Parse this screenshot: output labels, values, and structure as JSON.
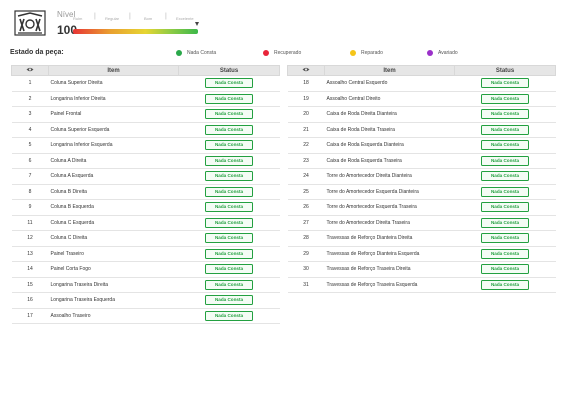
{
  "header": {
    "nivel_label": "Nível",
    "nivel_value": "100",
    "scale_labels": [
      "Ruim",
      "Regular",
      "Bom",
      "Excelente"
    ],
    "scale_level_percent": 100
  },
  "estado": {
    "title": "Estado da peça:",
    "legend": [
      {
        "label": "Nada Consta",
        "color": "#2aa84a"
      },
      {
        "label": "Recuperado",
        "color": "#e8253a"
      },
      {
        "label": "Reparado",
        "color": "#f5c518"
      },
      {
        "label": "Avariado",
        "color": "#9b30c9"
      }
    ]
  },
  "table": {
    "col_item": "Item",
    "col_status": "Status",
    "eye_icon": "eye-icon",
    "status_color": "#23a040"
  },
  "left_rows": [
    {
      "num": "1",
      "item": "Coluna Superior Direita",
      "status": "Nada Consta"
    },
    {
      "num": "2",
      "item": "Longarina Inferior Direita",
      "status": "Nada Consta"
    },
    {
      "num": "3",
      "item": "Painel Frontal",
      "status": "Nada Consta"
    },
    {
      "num": "4",
      "item": "Coluna Superior Esquerda",
      "status": "Nada Consta"
    },
    {
      "num": "5",
      "item": "Longarina Inferior Esquerda",
      "status": "Nada Consta"
    },
    {
      "num": "6",
      "item": "Coluna A Direita",
      "status": "Nada Consta"
    },
    {
      "num": "7",
      "item": "Coluna A Esquerda",
      "status": "Nada Consta"
    },
    {
      "num": "8",
      "item": "Coluna B Direita",
      "status": "Nada Consta"
    },
    {
      "num": "9",
      "item": "Coluna B Esquerda",
      "status": "Nada Consta"
    },
    {
      "num": "11",
      "item": "Coluna C Esquerda",
      "status": "Nada Consta"
    },
    {
      "num": "12",
      "item": "Coluna C Direita",
      "status": "Nada Consta"
    },
    {
      "num": "13",
      "item": "Painel Traseiro",
      "status": "Nada Consta"
    },
    {
      "num": "14",
      "item": "Painel Corta Fogo",
      "status": "Nada Consta"
    },
    {
      "num": "15",
      "item": "Longarina Traseira Direita",
      "status": "Nada Consta"
    },
    {
      "num": "16",
      "item": "Longarina Traseira Esquerda",
      "status": "Nada Consta"
    },
    {
      "num": "17",
      "item": "Assoalho Traseiro",
      "status": "Nada Consta"
    }
  ],
  "right_rows": [
    {
      "num": "18",
      "item": "Assoalho Central Esquerdo",
      "status": "Nada Consta"
    },
    {
      "num": "19",
      "item": "Assoalho Central Direito",
      "status": "Nada Consta"
    },
    {
      "num": "20",
      "item": "Caixa de Roda Direita Dianteira",
      "status": "Nada Consta"
    },
    {
      "num": "21",
      "item": "Caixa de Roda Direita Traseira",
      "status": "Nada Consta"
    },
    {
      "num": "22",
      "item": "Caixa de Roda Esquerda Dianteira",
      "status": "Nada Consta"
    },
    {
      "num": "23",
      "item": "Caixa de Roda Esquerda Traseira",
      "status": "Nada Consta"
    },
    {
      "num": "24",
      "item": "Torre do Amortecedor Direita Dianteira",
      "status": "Nada Consta"
    },
    {
      "num": "25",
      "item": "Torre do Amortecedor Esquerda Dianteira",
      "status": "Nada Consta"
    },
    {
      "num": "26",
      "item": "Torre do Amortecedor Esquerda Traseira",
      "status": "Nada Consta"
    },
    {
      "num": "27",
      "item": "Torre do Amortecedor Direita Traseira",
      "status": "Nada Consta"
    },
    {
      "num": "28",
      "item": "Travessas de Reforço Dianteira Direita",
      "status": "Nada Consta"
    },
    {
      "num": "29",
      "item": "Travessas de Reforço Dianteira Esquerda",
      "status": "Nada Consta"
    },
    {
      "num": "30",
      "item": "Travessas de Reforço Traseira Direita",
      "status": "Nada Consta"
    },
    {
      "num": "31",
      "item": "Travessas de Reforço Traseira Esquerda",
      "status": "Nada Consta"
    }
  ]
}
